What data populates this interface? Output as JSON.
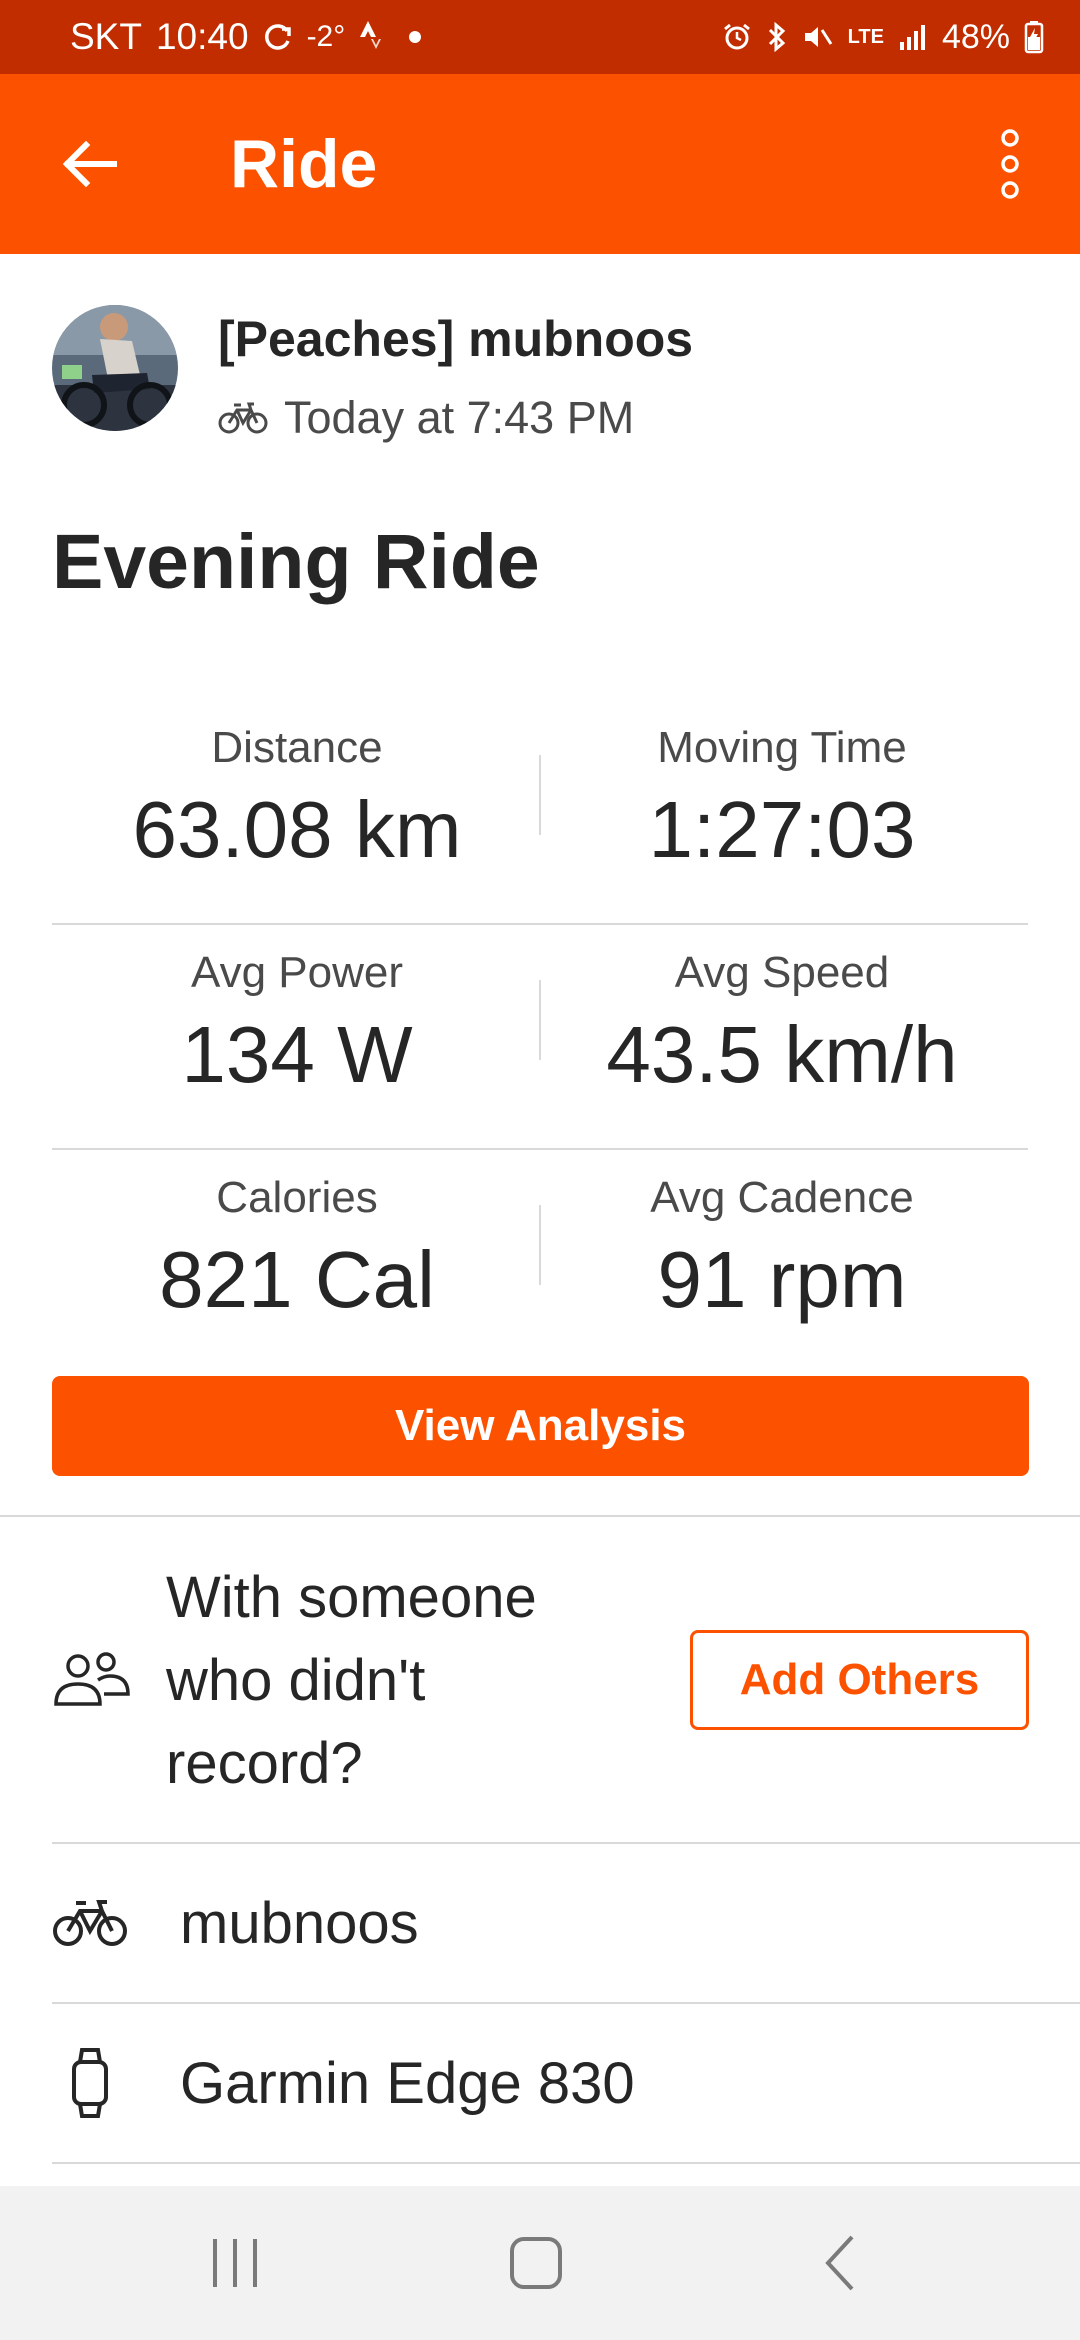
{
  "status_bar": {
    "carrier": "SKT",
    "time": "10:40",
    "temperature": "-2°",
    "battery": "48%",
    "network": "LTE"
  },
  "app_bar": {
    "title": "Ride",
    "back_icon": "arrow-left-icon",
    "menu_icon": "more-vertical-icon"
  },
  "activity": {
    "athlete_name": "[Peaches] mubnoos",
    "date": "Today at 7:43 PM",
    "sport_icon": "bike-icon",
    "title": "Evening Ride"
  },
  "stats": [
    {
      "left": {
        "label": "Distance",
        "value": "63.08 km"
      },
      "right": {
        "label": "Moving Time",
        "value": "1:27:03"
      }
    },
    {
      "left": {
        "label": "Avg Power",
        "value": "134 W"
      },
      "right": {
        "label": "Avg Speed",
        "value": "43.5 km/h"
      }
    },
    {
      "left": {
        "label": "Calories",
        "value": "821 Cal"
      },
      "right": {
        "label": "Avg Cadence",
        "value": "91 rpm"
      }
    }
  ],
  "analysis_button": "View Analysis",
  "with_others": {
    "line1": "With someone",
    "line2": "who didn't",
    "line3": "record?",
    "button": "Add Others"
  },
  "gear": {
    "bike": "mubnoos",
    "device": "Garmin Edge 830"
  },
  "colors": {
    "brand": "#fc5200",
    "status_bar": "#c22d00",
    "text": "#262626",
    "divider": "#d9d9d9"
  }
}
